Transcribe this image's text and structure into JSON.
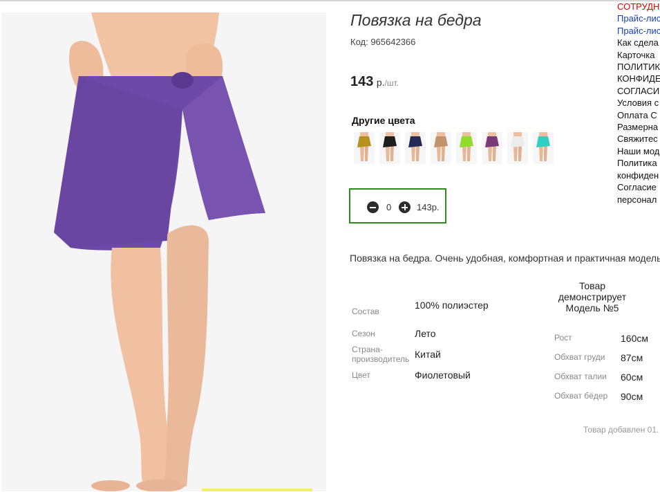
{
  "product": {
    "title": "Повязка на бедра",
    "code": "Код: 965642366",
    "price": "143",
    "currency": "р.",
    "unit": "/шт.",
    "other_colors_label": "Другие цвета",
    "swatches": [
      {
        "name": "mustard",
        "color": "#b5921e"
      },
      {
        "name": "black",
        "color": "#1d1d1d"
      },
      {
        "name": "navy",
        "color": "#232a55"
      },
      {
        "name": "beige",
        "color": "#c2946c"
      },
      {
        "name": "lime",
        "color": "#8fdc2a"
      },
      {
        "name": "plum",
        "color": "#7a3978"
      },
      {
        "name": "white",
        "color": "#ececec"
      },
      {
        "name": "turquoise",
        "color": "#2ed0c1"
      }
    ],
    "quantity": "0",
    "quantity_total": "143р.",
    "description": "Повязка на бедра. Очень удобная, комфортная и практичная модель",
    "attributes": [
      {
        "label": "Состав",
        "value": "100% полиэстер"
      },
      {
        "label": "Сезон",
        "value": "Лето"
      },
      {
        "label": "Страна-производитель",
        "value": "Китай"
      },
      {
        "label": "Цвет",
        "value": "Фиолетовый"
      }
    ],
    "model_heading": "Товар демонстрирует Модель №5",
    "measurements": [
      {
        "label": "Рост",
        "value": "160см"
      },
      {
        "label": "Обхват груди",
        "value": "87см"
      },
      {
        "label": "Обхват талии",
        "value": "60см"
      },
      {
        "label": "Обхват бёдер",
        "value": "90см"
      }
    ],
    "added_text": "Товар добавлен 01."
  },
  "sidebar": {
    "items": [
      {
        "text": "СОТРУДН",
        "style": "red"
      },
      {
        "text": "Прайс-лис",
        "style": "blue"
      },
      {
        "text": "Прайс-лис",
        "style": "blue"
      },
      {
        "text": "Как сдела",
        "style": "black"
      },
      {
        "text": "Карточка",
        "style": "black"
      },
      {
        "text": "ПОЛИТИК",
        "style": "black"
      },
      {
        "text": "КОНФИДЕ",
        "style": "black"
      },
      {
        "text": "СОГЛАСИ",
        "style": "black"
      },
      {
        "text": "Условия с",
        "style": "black"
      },
      {
        "text": "Оплата С",
        "style": "black"
      },
      {
        "text": "Размерна",
        "style": "black"
      },
      {
        "text": "Свяжитес",
        "style": "black"
      },
      {
        "text": "Наши мод",
        "style": "black"
      },
      {
        "text": "Политика",
        "style": "black"
      },
      {
        "text": "конфиден",
        "style": "black"
      },
      {
        "text": "Согласие",
        "style": "black"
      },
      {
        "text": "персонал",
        "style": "black"
      }
    ]
  },
  "colors": {
    "skirt": "#6e4aa8",
    "frame_border": "#2e8b1f"
  }
}
